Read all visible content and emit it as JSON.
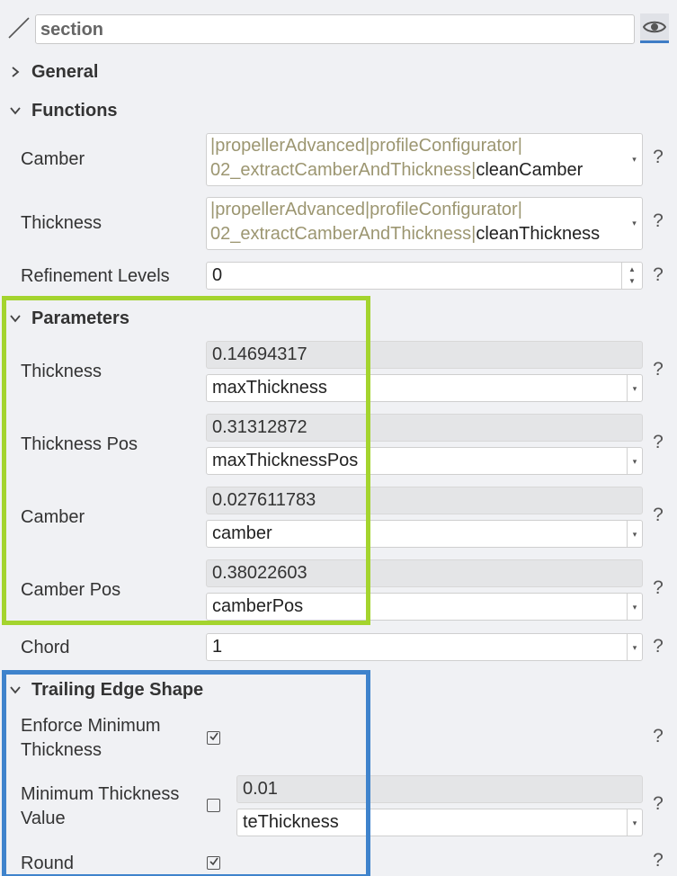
{
  "header": {
    "object_name": "section",
    "icons": {
      "object_icon": "line-icon",
      "visibility_icon": "eye-icon"
    }
  },
  "sections": {
    "general": {
      "title": "General",
      "expanded": false
    },
    "functions": {
      "title": "Functions",
      "expanded": true,
      "rows": [
        {
          "label": "Camber",
          "path_line1": "|propellerAdvanced|profileConfigurator|",
          "path_line2": "02_extractCamberAndThickness|",
          "name": "cleanCamber",
          "help": "?"
        },
        {
          "label": "Thickness",
          "path_line1": "|propellerAdvanced|profileConfigurator|",
          "path_line2": "02_extractCamberAndThickness|",
          "name": "cleanThickness",
          "help": "?"
        },
        {
          "label": "Refinement Levels",
          "value": "0",
          "help": "?"
        }
      ]
    },
    "parameters": {
      "title": "Parameters",
      "expanded": true,
      "rows": [
        {
          "label": "Thickness",
          "value": "0.14694317",
          "expression": "maxThickness",
          "help": "?"
        },
        {
          "label": "Thickness Pos",
          "value": "0.31312872",
          "expression": "maxThicknessPos",
          "help": "?"
        },
        {
          "label": "Camber",
          "value": "0.027611783",
          "expression": "camber",
          "help": "?"
        },
        {
          "label": "Camber Pos",
          "value": "0.38022603",
          "expression": "camberPos",
          "help": "?"
        }
      ],
      "chord": {
        "label": "Chord",
        "value": "1",
        "help": "?"
      }
    },
    "trailing_edge": {
      "title": "Trailing Edge Shape",
      "expanded": true,
      "enforce_min": {
        "label_line1": "Enforce Minimum",
        "label_line2": "Thickness",
        "checked": true,
        "help": "?"
      },
      "min_value": {
        "label_line1": "Minimum Thickness",
        "label_line2": "Value",
        "checked": false,
        "value": "0.01",
        "expression": "teThickness",
        "help": "?"
      },
      "round": {
        "label": "Round",
        "checked": true,
        "help": "?"
      }
    }
  },
  "colors": {
    "highlight_parameters": "#a4d42e",
    "highlight_trailing_edge": "#3f83cc",
    "path_text": "#9c9671",
    "panel_background": "#f0f1f4"
  }
}
